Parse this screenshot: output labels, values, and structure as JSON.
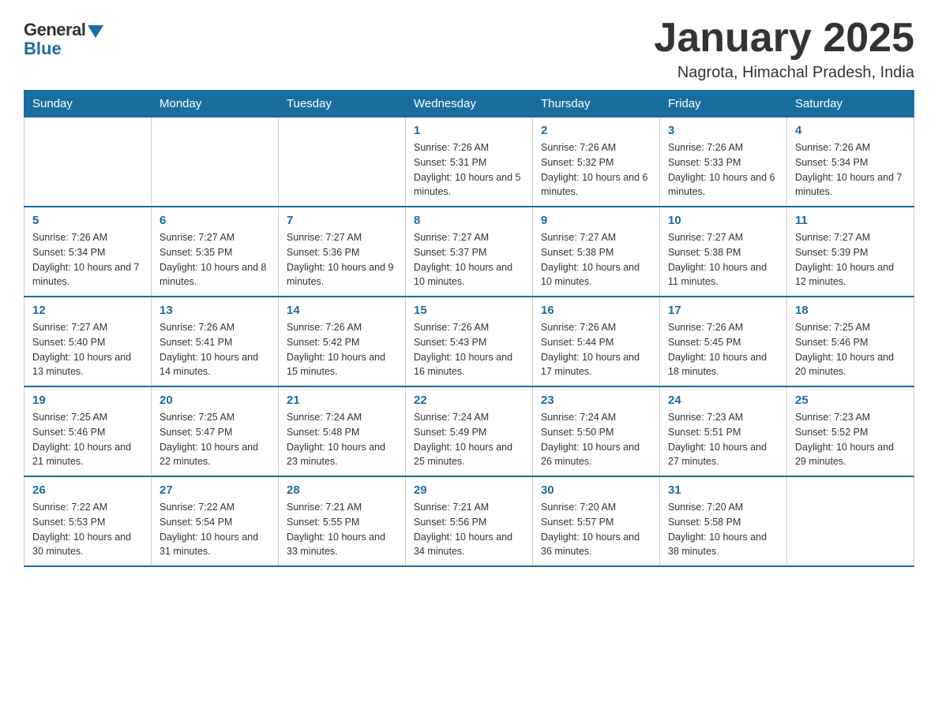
{
  "logo": {
    "general": "General",
    "blue": "Blue"
  },
  "title": "January 2025",
  "subtitle": "Nagrota, Himachal Pradesh, India",
  "days_of_week": [
    "Sunday",
    "Monday",
    "Tuesday",
    "Wednesday",
    "Thursday",
    "Friday",
    "Saturday"
  ],
  "weeks": [
    [
      null,
      null,
      null,
      {
        "day": "1",
        "sunrise": "7:26 AM",
        "sunset": "5:31 PM",
        "daylight": "10 hours and 5 minutes."
      },
      {
        "day": "2",
        "sunrise": "7:26 AM",
        "sunset": "5:32 PM",
        "daylight": "10 hours and 6 minutes."
      },
      {
        "day": "3",
        "sunrise": "7:26 AM",
        "sunset": "5:33 PM",
        "daylight": "10 hours and 6 minutes."
      },
      {
        "day": "4",
        "sunrise": "7:26 AM",
        "sunset": "5:34 PM",
        "daylight": "10 hours and 7 minutes."
      }
    ],
    [
      {
        "day": "5",
        "sunrise": "7:26 AM",
        "sunset": "5:34 PM",
        "daylight": "10 hours and 7 minutes."
      },
      {
        "day": "6",
        "sunrise": "7:27 AM",
        "sunset": "5:35 PM",
        "daylight": "10 hours and 8 minutes."
      },
      {
        "day": "7",
        "sunrise": "7:27 AM",
        "sunset": "5:36 PM",
        "daylight": "10 hours and 9 minutes."
      },
      {
        "day": "8",
        "sunrise": "7:27 AM",
        "sunset": "5:37 PM",
        "daylight": "10 hours and 10 minutes."
      },
      {
        "day": "9",
        "sunrise": "7:27 AM",
        "sunset": "5:38 PM",
        "daylight": "10 hours and 10 minutes."
      },
      {
        "day": "10",
        "sunrise": "7:27 AM",
        "sunset": "5:38 PM",
        "daylight": "10 hours and 11 minutes."
      },
      {
        "day": "11",
        "sunrise": "7:27 AM",
        "sunset": "5:39 PM",
        "daylight": "10 hours and 12 minutes."
      }
    ],
    [
      {
        "day": "12",
        "sunrise": "7:27 AM",
        "sunset": "5:40 PM",
        "daylight": "10 hours and 13 minutes."
      },
      {
        "day": "13",
        "sunrise": "7:26 AM",
        "sunset": "5:41 PM",
        "daylight": "10 hours and 14 minutes."
      },
      {
        "day": "14",
        "sunrise": "7:26 AM",
        "sunset": "5:42 PM",
        "daylight": "10 hours and 15 minutes."
      },
      {
        "day": "15",
        "sunrise": "7:26 AM",
        "sunset": "5:43 PM",
        "daylight": "10 hours and 16 minutes."
      },
      {
        "day": "16",
        "sunrise": "7:26 AM",
        "sunset": "5:44 PM",
        "daylight": "10 hours and 17 minutes."
      },
      {
        "day": "17",
        "sunrise": "7:26 AM",
        "sunset": "5:45 PM",
        "daylight": "10 hours and 18 minutes."
      },
      {
        "day": "18",
        "sunrise": "7:25 AM",
        "sunset": "5:46 PM",
        "daylight": "10 hours and 20 minutes."
      }
    ],
    [
      {
        "day": "19",
        "sunrise": "7:25 AM",
        "sunset": "5:46 PM",
        "daylight": "10 hours and 21 minutes."
      },
      {
        "day": "20",
        "sunrise": "7:25 AM",
        "sunset": "5:47 PM",
        "daylight": "10 hours and 22 minutes."
      },
      {
        "day": "21",
        "sunrise": "7:24 AM",
        "sunset": "5:48 PM",
        "daylight": "10 hours and 23 minutes."
      },
      {
        "day": "22",
        "sunrise": "7:24 AM",
        "sunset": "5:49 PM",
        "daylight": "10 hours and 25 minutes."
      },
      {
        "day": "23",
        "sunrise": "7:24 AM",
        "sunset": "5:50 PM",
        "daylight": "10 hours and 26 minutes."
      },
      {
        "day": "24",
        "sunrise": "7:23 AM",
        "sunset": "5:51 PM",
        "daylight": "10 hours and 27 minutes."
      },
      {
        "day": "25",
        "sunrise": "7:23 AM",
        "sunset": "5:52 PM",
        "daylight": "10 hours and 29 minutes."
      }
    ],
    [
      {
        "day": "26",
        "sunrise": "7:22 AM",
        "sunset": "5:53 PM",
        "daylight": "10 hours and 30 minutes."
      },
      {
        "day": "27",
        "sunrise": "7:22 AM",
        "sunset": "5:54 PM",
        "daylight": "10 hours and 31 minutes."
      },
      {
        "day": "28",
        "sunrise": "7:21 AM",
        "sunset": "5:55 PM",
        "daylight": "10 hours and 33 minutes."
      },
      {
        "day": "29",
        "sunrise": "7:21 AM",
        "sunset": "5:56 PM",
        "daylight": "10 hours and 34 minutes."
      },
      {
        "day": "30",
        "sunrise": "7:20 AM",
        "sunset": "5:57 PM",
        "daylight": "10 hours and 36 minutes."
      },
      {
        "day": "31",
        "sunrise": "7:20 AM",
        "sunset": "5:58 PM",
        "daylight": "10 hours and 38 minutes."
      },
      null
    ]
  ]
}
